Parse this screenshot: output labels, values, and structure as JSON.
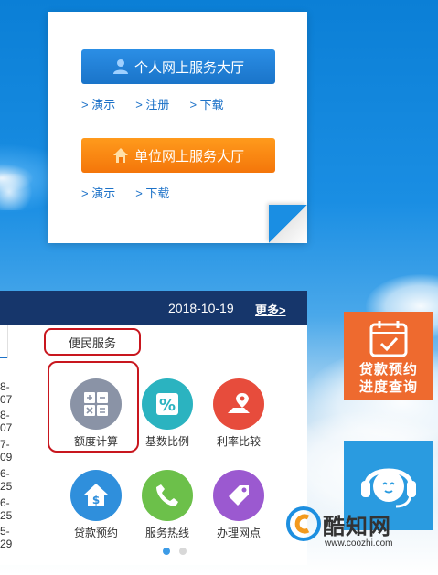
{
  "personal_hall": {
    "label": "个人网上服务大厅",
    "links": [
      "> 演示",
      "> 注册",
      "> 下载"
    ]
  },
  "unit_hall": {
    "label": "单位网上服务大厅",
    "links": [
      "> 演示",
      "> 下载"
    ]
  },
  "news": {
    "date": "2018-10-19",
    "more": "更多>",
    "item_dates": [
      "8-07",
      "8-07",
      "7-09",
      "6-25",
      "6-25",
      "5-29"
    ]
  },
  "tabs": {
    "service": "便民服务"
  },
  "services": [
    {
      "label": "额度计算",
      "icon": "calculator-icon",
      "color": "#8a93a6"
    },
    {
      "label": "基数比例",
      "icon": "percent-icon",
      "color": "#2bb3c0"
    },
    {
      "label": "利率比较",
      "icon": "map-pin-icon",
      "color": "#e74c3c"
    },
    {
      "label": "贷款预约",
      "icon": "house-dollar-icon",
      "color": "#2f8fdc"
    },
    {
      "label": "服务热线",
      "icon": "phone-icon",
      "color": "#6cc04a"
    },
    {
      "label": "办理网点",
      "icon": "tag-icon",
      "color": "#9b59d0"
    }
  ],
  "widgets": {
    "loan_line1": "贷款预约",
    "loan_line2": "进度查询"
  },
  "watermark": {
    "name": "酷知网",
    "url": "www.coozhi.com"
  },
  "colors": {
    "highlight": "#c8161e",
    "dark_bar": "#16366b",
    "accent_blue": "#1d72c8",
    "accent_orange": "#f4760a"
  }
}
